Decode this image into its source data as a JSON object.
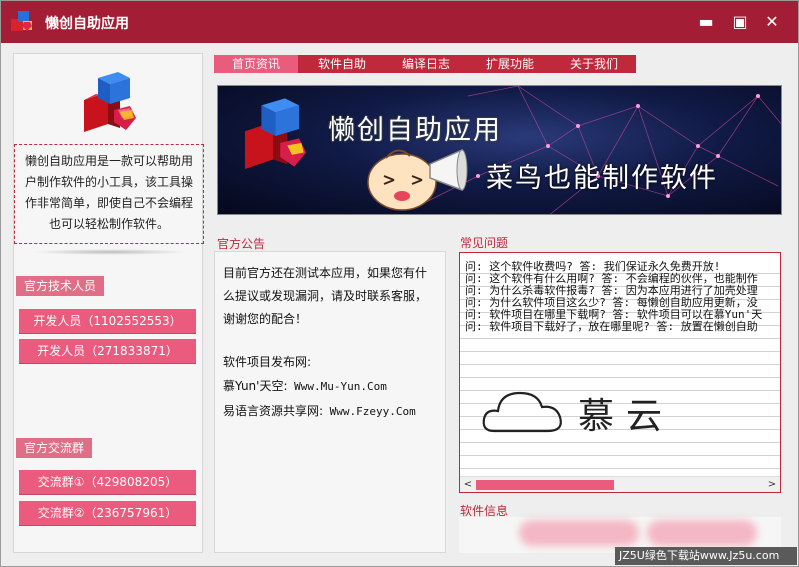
{
  "window": {
    "title": "懒创自助应用",
    "minimize_glyph": "▬",
    "maximize_glyph": "▣",
    "close_glyph": "✕"
  },
  "colors": {
    "titlebar": "#a31e34",
    "accent": "#c0283c",
    "button": "#ea5b7e"
  },
  "tabs": [
    {
      "label": "首页资讯"
    },
    {
      "label": "软件自助"
    },
    {
      "label": "编译日志"
    },
    {
      "label": "扩展功能"
    },
    {
      "label": "关于我们"
    }
  ],
  "left": {
    "intro": "懒创自助应用是一款可以帮助用户制作软件的小工具，该工具操作非常简单，即使自己不会编程也可以轻松制作软件。",
    "tech_label": "官方技术人员",
    "developers": [
      "开发人员（1102552553）",
      "开发人员（271833871）"
    ],
    "group_label": "官方交流群",
    "groups": [
      "交流群①（429808205）",
      "交流群②（236757961）"
    ]
  },
  "banner": {
    "title": "懒创自助应用",
    "subtitle": "菜鸟也能制作软件"
  },
  "notice": {
    "label": "官方公告",
    "text": "目前官方还在测试本应用，如果您有什么提议或发现漏洞，请及时联系客服，谢谢您的配合！",
    "release_label": "软件项目发布网:",
    "sites": [
      {
        "name": "慕Yun'天空:",
        "url": "Www.Mu-Yun.Com"
      },
      {
        "name": "易语言资源共享网:",
        "url": "Www.Fzeyy.Com"
      }
    ]
  },
  "faq": {
    "label": "常见问题",
    "lines": [
      "问: 这个软件收费吗? 答: 我们保证永久免费开放!",
      "问: 这个软件有什么用啊? 答: 不会编程的伙伴，也能制作",
      "问: 为什么杀毒软件报毒? 答: 因为本应用进行了加壳处理",
      "问: 为什么软件项目这么少? 答: 每懒创自助应用更新，没",
      "问: 软件项目在哪里下载啊? 答: 软件项目可以在慕Yun'天",
      "问: 软件项目下载好了，放在哪里呢? 答: 放置在懒创自助"
    ],
    "art_text": "慕云",
    "scroll_left": "<",
    "scroll_right": ">"
  },
  "info": {
    "label": "软件信息"
  },
  "watermark": "JZ5U绿色下载站www.Jz5u.com"
}
